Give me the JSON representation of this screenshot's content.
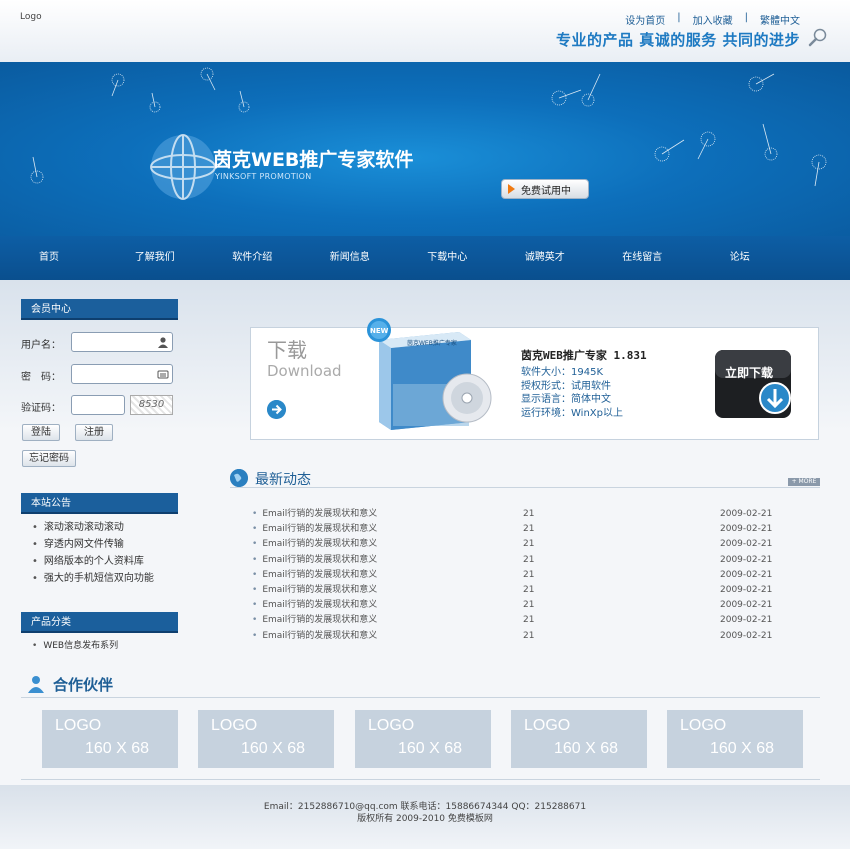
{
  "header": {
    "logo": "Logo",
    "links": [
      "设为首页",
      "加入收藏",
      "繁體中文"
    ],
    "separator": "|",
    "slogan": "专业的产品  真诚的服务  共同的进步"
  },
  "banner": {
    "title": "茵克WEB推广专家软件",
    "subtitle": "YINKSOFT PROMOTION",
    "trial_button": "免费试用中"
  },
  "nav": {
    "items": [
      "首页",
      "了解我们",
      "软件介绍",
      "新闻信息",
      "下载中心",
      "诚聘英才",
      "在线留言",
      "论坛"
    ]
  },
  "member": {
    "heading": "会员中心",
    "username_label": "用户名：",
    "password_label": "密　码：",
    "captcha_label": "验证码：",
    "captcha_value": "8530",
    "login_button": "登陆",
    "register_button": "注册",
    "forgot_button": "忘记密码"
  },
  "notice": {
    "heading": "本站公告",
    "items": [
      "滚动滚动滚动滚动",
      "穿透内网文件传输",
      "网络版本的个人资料库",
      "强大的手机短信双向功能"
    ]
  },
  "category": {
    "heading": "产品分类",
    "items": [
      "WEB信息发布系列"
    ]
  },
  "download": {
    "title": "下载",
    "subtitle": "Download",
    "badge": "NEW",
    "box_label": "茵克WEB推广专家",
    "product_name": "茵克WEB推广专家  1.831",
    "info": [
      "软件大小：1945K",
      "授权形式：试用软件",
      "显示语言：简体中文",
      "运行环境：WinXp以上"
    ],
    "download_button": "立即下载"
  },
  "news": {
    "heading": "最新动态",
    "more": "+ MORE",
    "rows": [
      {
        "title": "Email行销的发展现状和意义",
        "count": "21",
        "date": "2009-02-21"
      },
      {
        "title": "Email行销的发展现状和意义",
        "count": "21",
        "date": "2009-02-21"
      },
      {
        "title": "Email行销的发展现状和意义",
        "count": "21",
        "date": "2009-02-21"
      },
      {
        "title": "Email行销的发展现状和意义",
        "count": "21",
        "date": "2009-02-21"
      },
      {
        "title": "Email行销的发展现状和意义",
        "count": "21",
        "date": "2009-02-21"
      },
      {
        "title": "Email行销的发展现状和意义",
        "count": "21",
        "date": "2009-02-21"
      },
      {
        "title": "Email行销的发展现状和意义",
        "count": "21",
        "date": "2009-02-21"
      },
      {
        "title": "Email行销的发展现状和意义",
        "count": "21",
        "date": "2009-02-21"
      },
      {
        "title": "Email行销的发展现状和意义",
        "count": "21",
        "date": "2009-02-21"
      }
    ]
  },
  "partners": {
    "heading": "合作伙伴",
    "logos": [
      {
        "line1": "LOGO",
        "line2": "160 X 68"
      },
      {
        "line1": "LOGO",
        "line2": "160 X 68"
      },
      {
        "line1": "LOGO",
        "line2": "160 X 68"
      },
      {
        "line1": "LOGO",
        "line2": "160 X 68"
      },
      {
        "line1": "LOGO",
        "line2": "160 X 68"
      }
    ]
  },
  "footer": {
    "line1": "Email：2152886710@qq.com  联系电话：15886674344 QQ：215288671",
    "line2": "版权所有 2009-2010 免费模板网"
  },
  "colors": {
    "brand_blue": "#0d6fbb",
    "nav_blue": "#0a4f8e",
    "heading_blue": "#1f5f96",
    "accent_orange": "#f07a12"
  }
}
